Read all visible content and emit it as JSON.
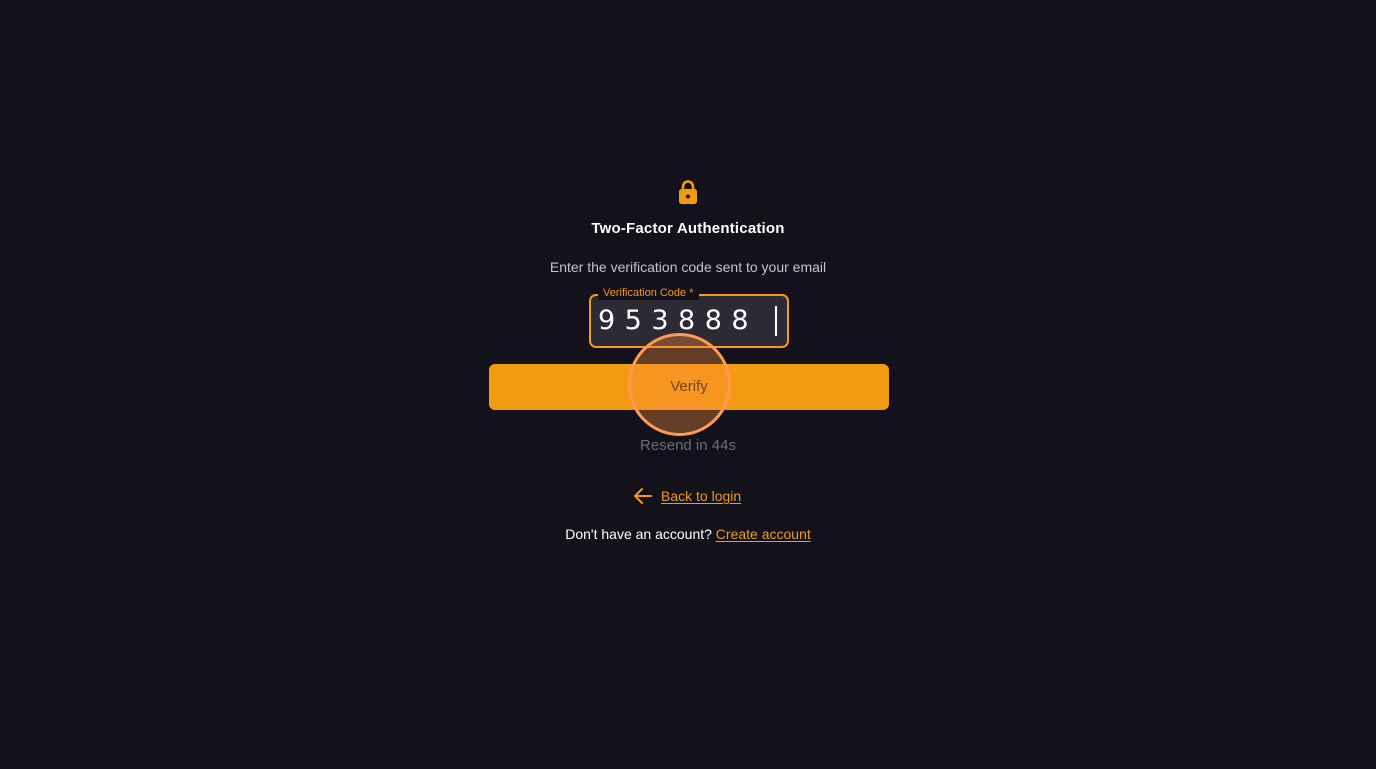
{
  "header": {
    "icon": "lock-icon",
    "title": "Two-Factor Authentication",
    "subtitle": "Enter the verification code sent to your email"
  },
  "verification_field": {
    "label": "Verification Code *",
    "value": "953888"
  },
  "verify_button": {
    "label": "Verify"
  },
  "resend": {
    "text": "Resend in 44s"
  },
  "back": {
    "icon": "arrow-left-icon",
    "label": "Back to login"
  },
  "signup": {
    "prompt": "Don't have an account?",
    "link_label": "Create account"
  },
  "colors": {
    "background": "#13121a",
    "accent": "#f39a13",
    "field_background": "#2b2a35",
    "muted_text": "#6f6d78"
  }
}
